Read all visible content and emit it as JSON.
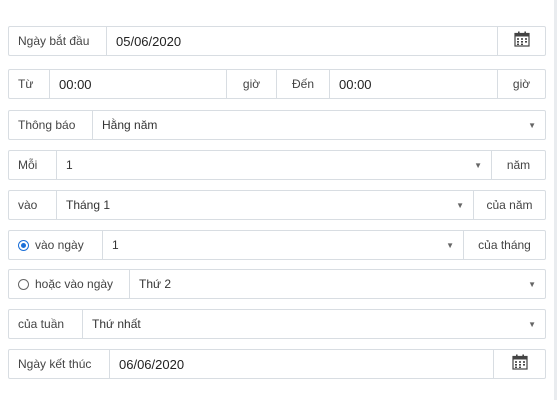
{
  "start_date": {
    "label": "Ngày bắt đầu",
    "value": "05/06/2020",
    "icon": "calendar-icon"
  },
  "time_range": {
    "from_label": "Từ",
    "from_value": "00:00",
    "from_unit": "giờ",
    "to_label": "Đến",
    "to_value": "00:00",
    "to_unit": "giờ"
  },
  "notify": {
    "label": "Thông báo",
    "value": "Hằng năm"
  },
  "every": {
    "label": "Mỗi",
    "value": "1",
    "unit": "năm"
  },
  "in_month": {
    "label": "vào",
    "value": "Tháng 1",
    "suffix": "của năm"
  },
  "on_day": {
    "label": "vào ngày",
    "value": "1",
    "suffix": "của tháng",
    "selected": true
  },
  "or_on_day": {
    "label": "hoặc vào ngày",
    "value": "Thứ 2",
    "selected": false
  },
  "of_week": {
    "label": "của tuần",
    "value": "Thứ nhất"
  },
  "end_date": {
    "label": "Ngày kết thúc",
    "value": "06/06/2020",
    "icon": "calendar-icon"
  },
  "colors": {
    "border": "#d8dde2",
    "radio_accent": "#1a6fd8"
  }
}
